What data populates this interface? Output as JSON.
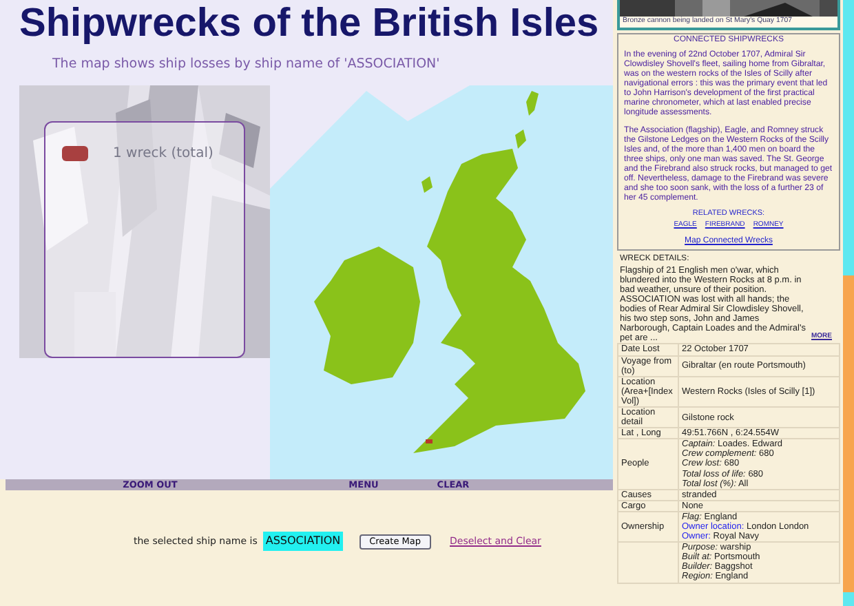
{
  "title": "Shipwrecks of the British Isles",
  "subtitle": "The map shows ship losses by ship name of 'ASSOCIATION'",
  "legend": {
    "label": "1 wreck (total)"
  },
  "menu": [
    "ZOOM OUT",
    "MENU",
    "CLEAR"
  ],
  "selection": {
    "label": "the selected ship name is",
    "value": "ASSOCIATION",
    "button": "Create Map",
    "link": "Deselect and Clear"
  },
  "photo_caption": "Bronze cannon being landed on St Mary's Quay 1707",
  "connected": {
    "heading": "CONNECTED SHIPWRECKS",
    "paragraphs": [
      "In the evening of 22nd October 1707, Admiral Sir Clowdisley Shovell's fleet, sailing home from Gibraltar, was on the western rocks of the Isles of Scilly after navigational errors : this was the primary event that led to John Harrison's development of the first practical marine chronometer, which at last enabled precise longitude assessments.",
      "The Association (flagship), Eagle, and Romney struck the Gilstone Ledges on the Western Rocks of the Scilly Isles and, of the more than 1,400 men on board the three ships, only one man was saved. The St. George and the Firebrand also struck rocks, but managed to get off. Nevertheless, damage to the Firebrand was severe and she too soon sank, with the loss of a further 23 of her 45 complement."
    ],
    "related_heading": "RELATED WRECKS:",
    "related": [
      "EAGLE",
      "FIREBRAND",
      "ROMNEY"
    ],
    "map_link": "Map Connected Wrecks"
  },
  "details": {
    "heading": "WRECK DETAILS:",
    "summary": "Flagship of 21 English men o'war, which blundered into the Western Rocks at 8 p.m. in bad weather, unsure of their position. ASSOCIATION was lost with all hands; the bodies of Rear Admiral Sir Clowdisley Shovell, his two step sons, John and James Narborough, Captain Loades and the Admiral's pet are ...",
    "more": "MORE",
    "rows": [
      {
        "label": "Date Lost",
        "lines": [
          {
            "value": "22 October 1707"
          }
        ]
      },
      {
        "label": "Voyage from (to)",
        "lines": [
          {
            "value": "Gibraltar (en route Portsmouth)"
          }
        ]
      },
      {
        "label": "Location (Area+[Index Vol])",
        "lines": [
          {
            "value": "Western Rocks (Isles of Scilly [1])"
          }
        ]
      },
      {
        "label": "Location detail",
        "lines": [
          {
            "value": "Gilstone rock"
          }
        ]
      },
      {
        "label": "Lat , Long",
        "lines": [
          {
            "value": "49:51.766N , 6:24.554W"
          }
        ]
      },
      {
        "label": "People",
        "lines": [
          {
            "key": "Captain:",
            "value": "Loades. Edward"
          },
          {
            "key": "Crew complement:",
            "value": "680"
          },
          {
            "key": "Crew lost:",
            "value": "680"
          },
          {
            "key": "Total loss of life:",
            "value": "680"
          },
          {
            "key": "Total lost (%):",
            "value": "All"
          }
        ]
      },
      {
        "label": "Causes",
        "lines": [
          {
            "value": "stranded"
          }
        ]
      },
      {
        "label": "Cargo",
        "lines": [
          {
            "value": "None"
          }
        ]
      },
      {
        "label": "Ownership",
        "lines": [
          {
            "key": "Flag:",
            "value": "England"
          },
          {
            "key": "Owner location:",
            "link": true,
            "value": "London London"
          },
          {
            "key": "Owner:",
            "link": true,
            "value": "Royal Navy"
          }
        ]
      },
      {
        "lines": [
          {
            "key": "Purpose:",
            "value": "warship"
          },
          {
            "key": "Built at:",
            "value": "Portsmouth"
          },
          {
            "key": "Builder:",
            "value": "Baggshot"
          },
          {
            "key": "Region:",
            "value": "England"
          }
        ]
      }
    ]
  }
}
